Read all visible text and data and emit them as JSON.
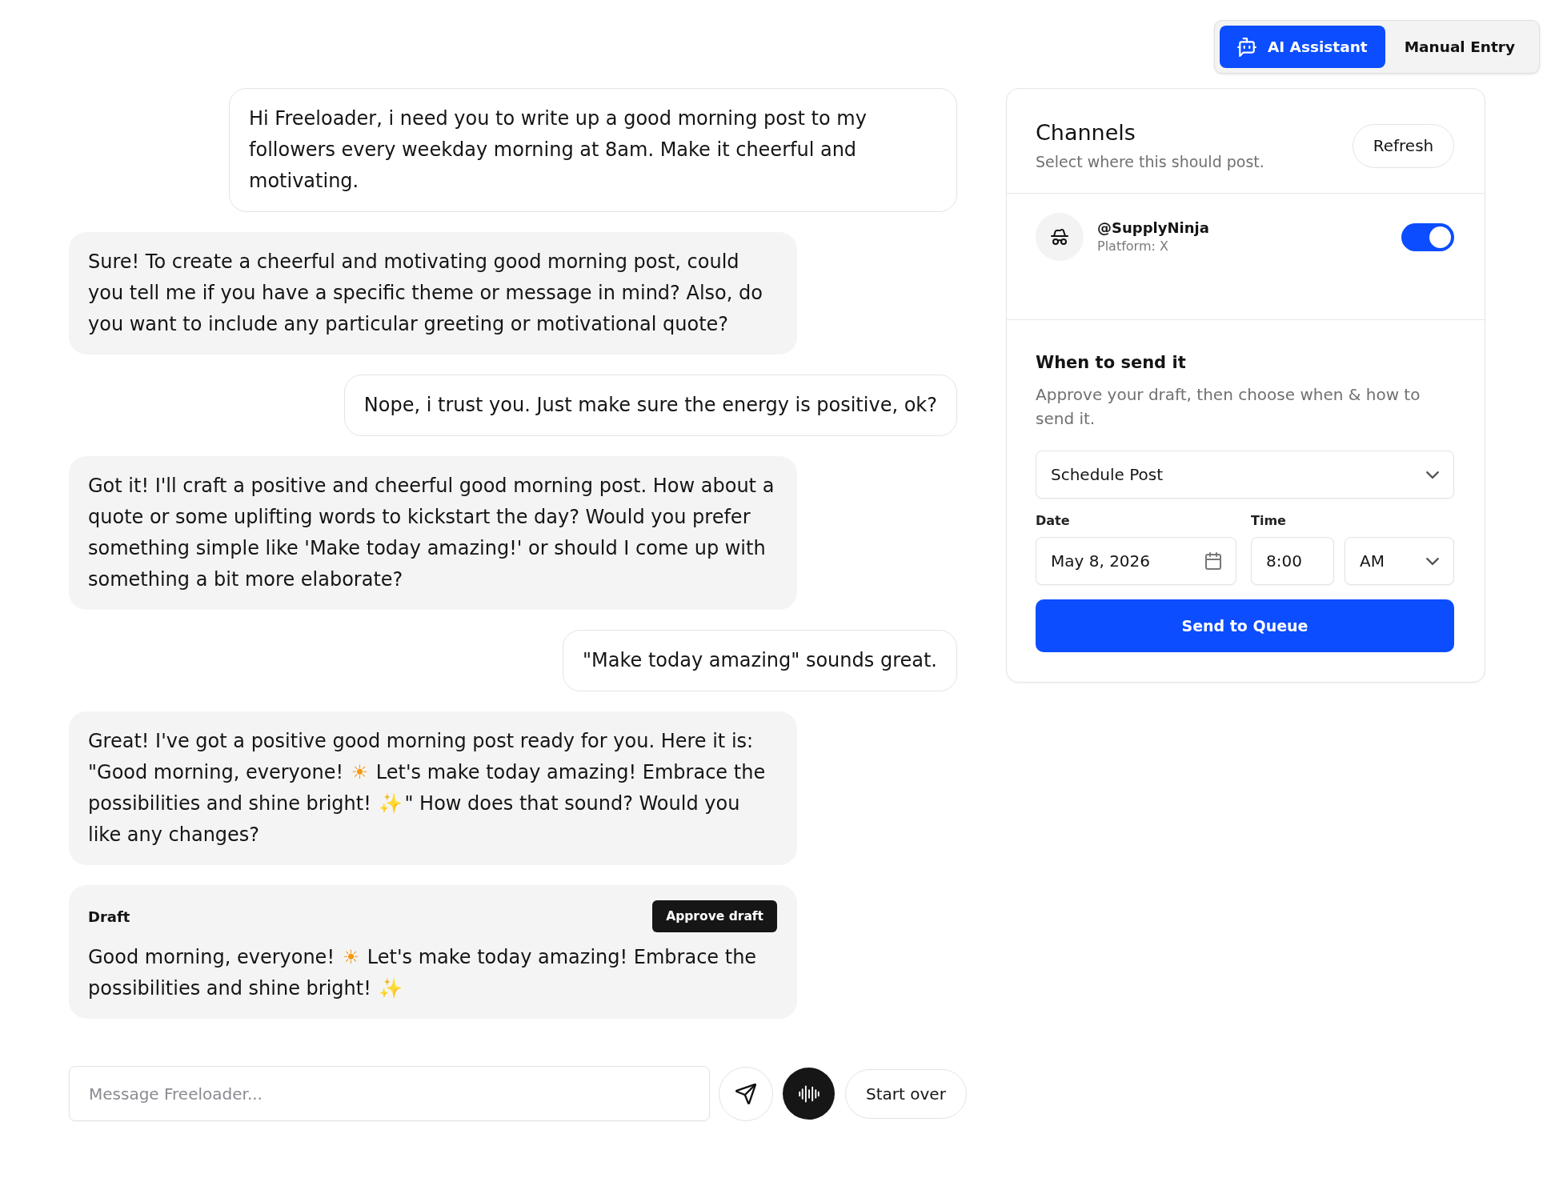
{
  "mode_tabs": [
    {
      "kind": "assistant",
      "label": "AI Assistant",
      "selected": true
    },
    {
      "kind": "manual",
      "label": "Manual Entry",
      "selected": false
    }
  ],
  "chat": {
    "messages": [
      {
        "kind": "user",
        "text": "Hi Freeloader, i need you to write up a good morning post to my followers every weekday morning at 8am. Make it cheerful and motivating."
      },
      {
        "kind": "assistant",
        "text": "Sure! To create a cheerful and motivating good morning post, could you tell me if you have a specific theme or message in mind? Also, do you want to include any particular greeting or motivational quote?"
      },
      {
        "kind": "user",
        "text": "Nope, i trust you. Just make sure the energy is positive, ok?"
      },
      {
        "kind": "assistant",
        "text": "Got it! I'll craft a positive and cheerful good morning post. How about a quote or some uplifting words to kickstart the day? Would you prefer something simple like 'Make today amazing!' or should I come up with something a bit more elaborate?"
      },
      {
        "kind": "user",
        "text": "\"Make today amazing\" sounds great."
      },
      {
        "kind": "assistant",
        "text": "Great! I've got a positive good morning post ready for you. Here it is: \"Good morning, everyone! ☀ Let's make today amazing! Embrace the possibilities and shine bright! ✨\" How does that sound? Would you like any changes?"
      }
    ],
    "draft": {
      "label": "Draft",
      "button": "Approve draft",
      "text": "Good morning, everyone! ☀ Let's make today amazing! Embrace the possibilities and shine bright! ✨"
    }
  },
  "composer": {
    "placeholder": "Message Freeloader...",
    "reset_button": "Start over"
  },
  "channels": {
    "title": "Channels",
    "subtitle": "Select where this should post.",
    "refresh_button": "Refresh",
    "items": [
      {
        "handle": "@SupplyNinja",
        "platform": "Platform: X",
        "on": true
      }
    ]
  },
  "schedule": {
    "title": "When to send it",
    "description": "Approve your draft, then choose when & how to send it.",
    "mode": "Schedule Post",
    "date_label": "Date",
    "date": "May 8, 2026",
    "time_label": "Time",
    "time": "8:00",
    "period": "AM",
    "submit_button": "Send to Queue"
  }
}
